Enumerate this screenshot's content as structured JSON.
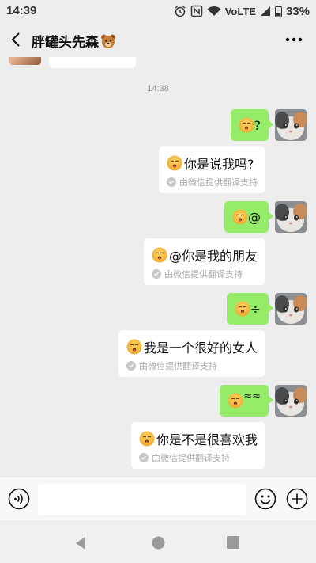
{
  "status_bar": {
    "time": "14:39",
    "battery": "33%",
    "volte": "VoLTE",
    "icons": [
      "alarm-icon",
      "nfc-icon",
      "wifi-icon",
      "volte-icon",
      "signal-icon",
      "battery-icon"
    ]
  },
  "header": {
    "title": "胖罐头先森",
    "title_emoji": "bear-face-icon",
    "back_icon": "chevron-left-icon",
    "more_icon": "more-dots-icon"
  },
  "chat": {
    "timestamp": "14:38",
    "messages": [
      {
        "sent_text": "?",
        "translation": "你是说我吗?",
        "translation_note": "由微信提供翻译支持"
      },
      {
        "sent_text": "@",
        "translation": "@你是我的朋友",
        "translation_note": "由微信提供翻译支持"
      },
      {
        "sent_text": "÷",
        "translation": "我是一个很好的女人",
        "translation_note": "由微信提供翻译支持"
      },
      {
        "sent_text": "≈≈",
        "translation": "你是不是很喜欢我",
        "translation_note": "由微信提供翻译支持"
      }
    ]
  },
  "input_bar": {
    "placeholder": "",
    "icons": [
      "voice-icon",
      "emoji-icon",
      "plus-icon"
    ]
  },
  "colors": {
    "background": "#ededed",
    "bubble_green": "#95ec69",
    "card_white": "#ffffff",
    "note_gray": "#aaaaaa"
  }
}
